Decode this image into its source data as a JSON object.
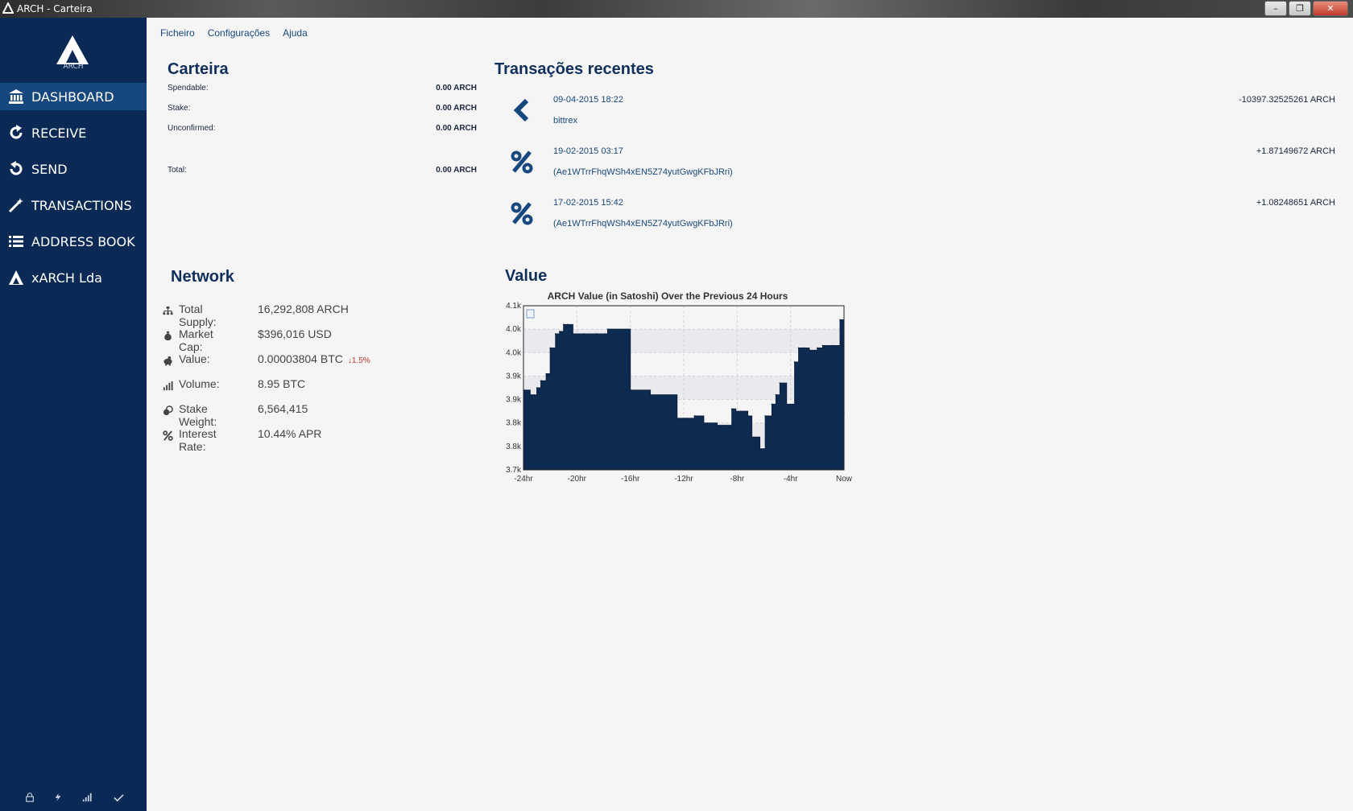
{
  "window": {
    "title": "ARCH - Carteira",
    "minimize_label": "–",
    "restore_label": "❐",
    "close_label": "✕"
  },
  "sidebar": {
    "logo_text": "ARCH",
    "items": [
      {
        "label": "DASHBOARD",
        "icon": "bank-icon",
        "active": true
      },
      {
        "label": "RECEIVE",
        "icon": "receive-arrow-icon",
        "active": false
      },
      {
        "label": "SEND",
        "icon": "send-arrow-icon",
        "active": false
      },
      {
        "label": "TRANSACTIONS",
        "icon": "magic-wand-icon",
        "active": false
      },
      {
        "label": "ADDRESS BOOK",
        "icon": "list-icon",
        "active": false
      },
      {
        "label": "xARCH Lda",
        "icon": "arch-logo-icon",
        "active": false
      }
    ],
    "status_icons": [
      "lock-icon",
      "bolt-icon",
      "signal-icon",
      "check-icon"
    ]
  },
  "menu": {
    "items": [
      "Ficheiro",
      "Configurações",
      "Ajuda"
    ]
  },
  "wallet": {
    "title": "Carteira",
    "spendable_label": "Spendable:",
    "spendable_value": "0.00 ARCH",
    "stake_label": "Stake:",
    "stake_value": "0.00 ARCH",
    "unconfirmed_label": "Unconfirmed:",
    "unconfirmed_value": "0.00 ARCH",
    "total_label": "Total:",
    "total_value": "0.00 ARCH"
  },
  "recent": {
    "title": "Transações recentes",
    "items": [
      {
        "date": "09-04-2015 18:22",
        "desc": "bittrex",
        "amount": "-10397.32525261 ARCH",
        "icon": "chevron-left-icon"
      },
      {
        "date": "19-02-2015 03:17",
        "desc": "(Ae1WTrrFhqWSh4xEN5Z74yutGwgKFbJRri)",
        "amount": "+1.87149672 ARCH",
        "icon": "percent-icon"
      },
      {
        "date": "17-02-2015 15:42",
        "desc": "(Ae1WTrrFhqWSh4xEN5Z74yutGwgKFbJRri)",
        "amount": "+1.08248651 ARCH",
        "icon": "percent-icon"
      }
    ]
  },
  "network": {
    "title": "Network",
    "total_supply_label": "Total Supply:",
    "total_supply_value": "16,292,808 ARCH",
    "market_cap_label": "Market Cap:",
    "market_cap_value": "$396,016 USD",
    "value_label": "Value:",
    "value_value": "0.00003804 BTC",
    "value_change": "↓1.5%",
    "volume_label": "Volume:",
    "volume_value": "8.95 BTC",
    "stake_weight_label": "Stake Weight:",
    "stake_weight_value": "6,564,415",
    "interest_rate_label": "Interest Rate:",
    "interest_rate_value": "10.44% APR"
  },
  "value_section": {
    "title": "Value"
  },
  "colors": {
    "sidebar": "#0a2a55",
    "active_item": "#17477f",
    "accent": "#0f2f5c",
    "chart_fill": "#0d2a50",
    "negative": "#c0392b"
  },
  "chart_data": {
    "type": "area",
    "title": "ARCH Value (in Satoshi) Over the Previous 24 Hours",
    "xlabel": "",
    "ylabel": "",
    "x_ticks": [
      "-24hr",
      "-20hr",
      "-16hr",
      "-12hr",
      "-8hr",
      "-4hr",
      "Now"
    ],
    "y_ticks": [
      "4.1k",
      "4.0k",
      "4.0k",
      "3.9k",
      "3.9k",
      "3.8k",
      "3.8k",
      "3.7k"
    ],
    "ylim": [
      3700,
      4050
    ],
    "grid": true,
    "series": [
      {
        "x": [
          -24,
          -23.5,
          -23,
          -22.7,
          -22.3,
          -22,
          -21.6,
          -21.3,
          -21,
          -20.7,
          -20.3,
          -19.5,
          -18.5,
          -17.9,
          -17.7,
          -16,
          -14.5,
          -12.5,
          -11.8,
          -11.2,
          -10.5,
          -9.5,
          -8.4,
          -8.1,
          -7.2,
          -6.9,
          -6.3,
          -5.9,
          -5.4,
          -5.1,
          -4.8,
          -4.3,
          -3.7,
          -3.4,
          -3.0,
          -2.6,
          -2.0,
          -1.6,
          -0.9,
          -0.3,
          0
        ],
        "y": [
          3870,
          3860,
          3875,
          3890,
          3905,
          3960,
          3990,
          3995,
          4010,
          4010,
          3990,
          3990,
          3990,
          3990,
          4000,
          3870,
          3860,
          3810,
          3810,
          3815,
          3800,
          3795,
          3830,
          3825,
          3815,
          3770,
          3745,
          3815,
          3840,
          3860,
          3885,
          3840,
          3930,
          3960,
          3960,
          3955,
          3960,
          3965,
          3965,
          4020,
          3820
        ]
      }
    ]
  }
}
